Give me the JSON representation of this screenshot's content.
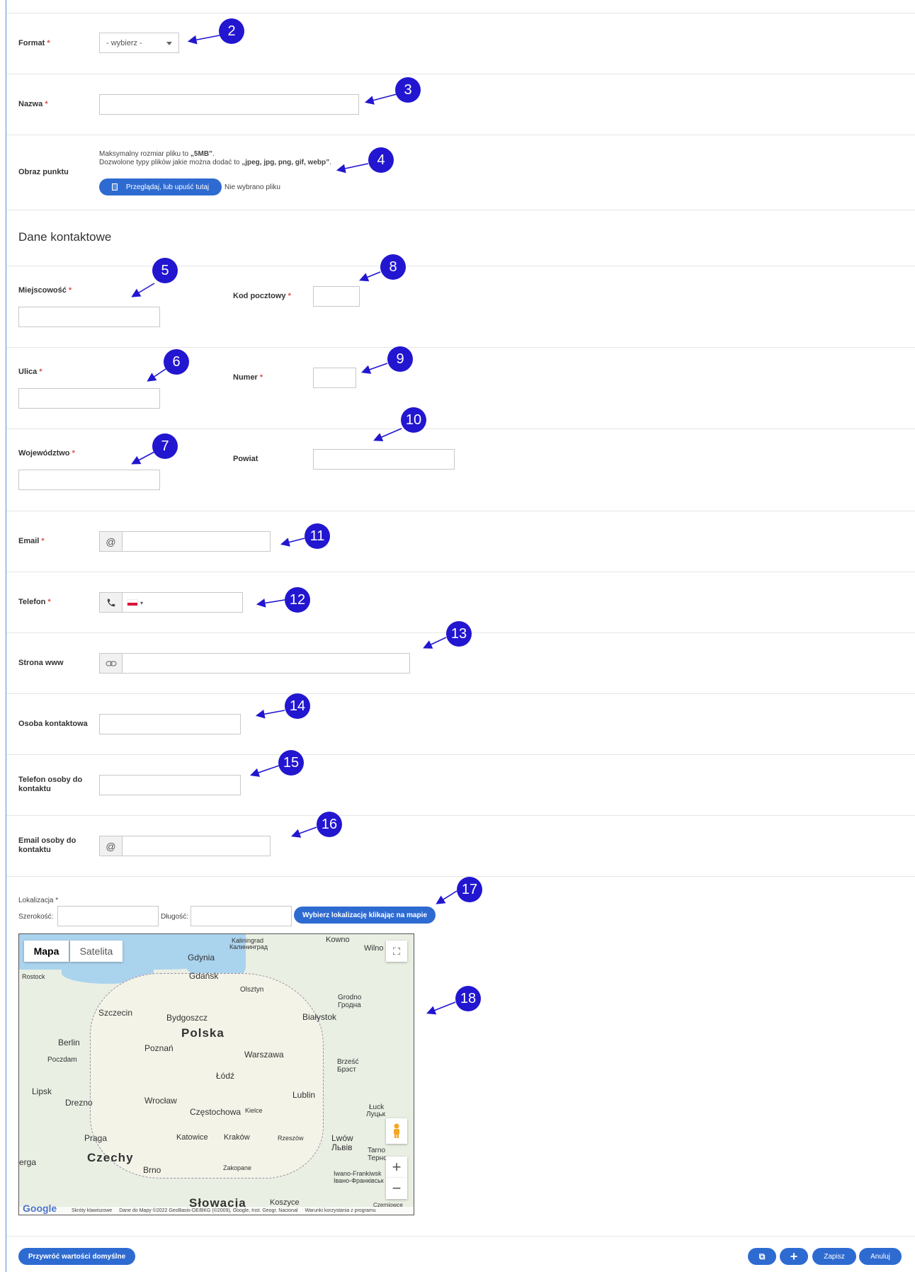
{
  "form": {
    "format": {
      "label": "Format",
      "required": "*",
      "value": "- wybierz -"
    },
    "nazwa": {
      "label": "Nazwa",
      "required": "*"
    },
    "obraz": {
      "label": "Obraz punktu",
      "max_size_prefix": "Maksymalny rozmiar pliku to ",
      "max_size_value": "„5MB”",
      "max_size_suffix": ".",
      "types_prefix": "Dozwolone typy plików jakie można dodać to ",
      "types_value": "„jpeg, jpg, png, gif, webp”",
      "types_suffix": ".",
      "browse_button": "Przeglądaj, lub upuść tutaj",
      "no_file": "Nie wybrano pliku"
    },
    "section_title": "Dane kontaktowe",
    "miejscowosc": {
      "label": "Miejscowość",
      "required": "*"
    },
    "kod": {
      "label": "Kod pocztowy",
      "required": "*"
    },
    "ulica": {
      "label": "Ulica",
      "required": "*"
    },
    "numer": {
      "label": "Numer",
      "required": "*"
    },
    "wojewodztwo": {
      "label": "Województwo",
      "required": "*"
    },
    "powiat": {
      "label": "Powiat"
    },
    "email": {
      "label": "Email",
      "required": "*",
      "addon": "@"
    },
    "telefon": {
      "label": "Telefon",
      "required": "*",
      "flag_caret": "▾"
    },
    "www": {
      "label": "Strona www"
    },
    "osoba": {
      "label": "Osoba kontaktowa"
    },
    "tel_osoby": {
      "label_line1": "Telefon osoby do",
      "label_line2": "kontaktu"
    },
    "email_osoby": {
      "label_line1": "Email osoby do",
      "label_line2": "kontaktu",
      "addon": "@"
    },
    "lokalizacja": {
      "label": "Lokalizacja *",
      "lat_label": "Szerokość:",
      "lng_label": "Długość:",
      "pick_button": "Wybierz lokalizację klikając na mapie"
    }
  },
  "map": {
    "tab_map": "Mapa",
    "tab_satellite": "Satelita",
    "cities": {
      "kaliningrad": "Kaliningrad",
      "kaliningrad_ru": "Калининград",
      "kowno": "Kowno",
      "wilno": "Wilno",
      "gdynia": "Gdynia",
      "gdansk": "Gdańsk",
      "rostock": "Rostock",
      "olsztyn": "Olsztyn",
      "grodno": "Grodno",
      "grodno_ru": "Гродна",
      "szczecin": "Szczecin",
      "bydgoszcz": "Bydgoszcz",
      "bialystok": "Białystok",
      "polska": "Polska",
      "berlin": "Berlin",
      "poczdam": "Poczdam",
      "poznan": "Poznań",
      "warszawa": "Warszawa",
      "brzesc": "Brześć",
      "brzesc_ru": "Брэст",
      "lodz": "Łódź",
      "lipsk": "Lipsk",
      "lublin": "Lublin",
      "drezno": "Drezno",
      "wroclaw": "Wrocław",
      "czestochowa": "Częstochowa",
      "kielce": "Kielce",
      "luck": "Łuck",
      "luck_ua": "Луцьк",
      "praga": "Praga",
      "katowice": "Katowice",
      "krakow": "Kraków",
      "rzeszow": "Rzeszów",
      "lwow": "Lwów",
      "lwow_ua": "Львів",
      "erga": "erga",
      "czechy": "Czechy",
      "tarno": "Tarno",
      "terno": "Терно",
      "brno": "Brno",
      "zakopane": "Zakopane",
      "iwano": "Iwano-Frankiwsk",
      "ivano_ua": "Івано-Франківськ",
      "slowacja": "Słowacja",
      "koszyce": "Koszyce",
      "czerniowce": "Czerniowce"
    },
    "google": "Google",
    "attrib_shortcuts": "Skróty klawiszowe",
    "attrib_data": "Dane do Mapy ©2022 GeoBasis-DE/BKG (©2009), Google, Inst. Geogr. Nacional",
    "attrib_terms": "Warunki korzystania z programu",
    "zoom_in": "+",
    "zoom_out": "−",
    "fullscreen": "⛶"
  },
  "footer": {
    "restore_button": "Przywróć wartości domyślne",
    "save_button": "Zapisz",
    "cancel_button": "Anuluj",
    "add_button": "+",
    "duplicate_icon": "⧉"
  },
  "badges": [
    "2",
    "3",
    "4",
    "5",
    "6",
    "7",
    "8",
    "9",
    "10",
    "11",
    "12",
    "13",
    "14",
    "15",
    "16",
    "17",
    "18"
  ],
  "colors": {
    "primary": "#2e6bd1",
    "badge": "#2216d0",
    "required": "#d9534f"
  }
}
